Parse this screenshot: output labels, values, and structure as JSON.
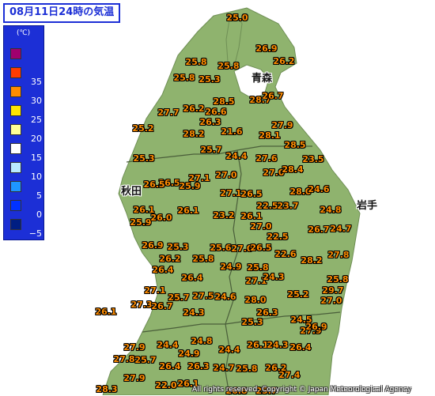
{
  "title": "08月11日24時の気温",
  "legend": {
    "unit": "(℃)",
    "items": [
      {
        "label": "",
        "color": "#a0006e"
      },
      {
        "label": "35",
        "color": "#ff3c00"
      },
      {
        "label": "30",
        "color": "#ff8c00"
      },
      {
        "label": "25",
        "color": "#ffe600"
      },
      {
        "label": "20",
        "color": "#ffff96"
      },
      {
        "label": "15",
        "color": "#ffffff"
      },
      {
        "label": "10",
        "color": "#b9ebff"
      },
      {
        "label": "5",
        "color": "#1e96ff"
      },
      {
        "label": "0",
        "color": "#0032ff"
      },
      {
        "label": "−5",
        "color": "#001e82"
      }
    ]
  },
  "prefectures": [
    "青森",
    "秋田",
    "岩手"
  ],
  "stations": [
    {
      "t": "25.0"
    },
    {
      "t": "26.9"
    },
    {
      "t": "26.2"
    },
    {
      "t": "25.8"
    },
    {
      "t": "25.8"
    },
    {
      "t": "25.8"
    },
    {
      "t": "25.3"
    },
    {
      "t": "28.5"
    },
    {
      "t": "28.7"
    },
    {
      "t": "26.7"
    },
    {
      "t": "27.7"
    },
    {
      "t": "26.2"
    },
    {
      "t": "26.6"
    },
    {
      "t": "26.3"
    },
    {
      "t": "25.2"
    },
    {
      "t": "28.2"
    },
    {
      "t": "21.6"
    },
    {
      "t": "27.9"
    },
    {
      "t": "28.1"
    },
    {
      "t": "25.7"
    },
    {
      "t": "28.5"
    },
    {
      "t": "25.3"
    },
    {
      "t": "24.4"
    },
    {
      "t": "27.6"
    },
    {
      "t": "23.5"
    },
    {
      "t": "27.0"
    },
    {
      "t": "28.4"
    },
    {
      "t": "26.5"
    },
    {
      "t": "27.1"
    },
    {
      "t": "27.0"
    },
    {
      "t": "26.5"
    },
    {
      "t": "25.9"
    },
    {
      "t": "27.1"
    },
    {
      "t": "26.5"
    },
    {
      "t": "28.0"
    },
    {
      "t": "24.6"
    },
    {
      "t": "22.5"
    },
    {
      "t": "23.7"
    },
    {
      "t": "26.1"
    },
    {
      "t": "26.1"
    },
    {
      "t": "23.2"
    },
    {
      "t": "26.1"
    },
    {
      "t": "24.8"
    },
    {
      "t": "25.9"
    },
    {
      "t": "26.0"
    },
    {
      "t": "27.0"
    },
    {
      "t": "26.7"
    },
    {
      "t": "24.7"
    },
    {
      "t": "22.5"
    },
    {
      "t": "26.9"
    },
    {
      "t": "25.3"
    },
    {
      "t": "25.6"
    },
    {
      "t": "27.0"
    },
    {
      "t": "26.5"
    },
    {
      "t": "26.2"
    },
    {
      "t": "25.8"
    },
    {
      "t": "22.6"
    },
    {
      "t": "28.2"
    },
    {
      "t": "27.8"
    },
    {
      "t": "26.4"
    },
    {
      "t": "24.9"
    },
    {
      "t": "25.8"
    },
    {
      "t": "26.4"
    },
    {
      "t": "27.1"
    },
    {
      "t": "24.3"
    },
    {
      "t": "25.8"
    },
    {
      "t": "27.1"
    },
    {
      "t": "25.2"
    },
    {
      "t": "29.7"
    },
    {
      "t": "25.7"
    },
    {
      "t": "27.5"
    },
    {
      "t": "24.6"
    },
    {
      "t": "28.0"
    },
    {
      "t": "27.0"
    },
    {
      "t": "27.3"
    },
    {
      "t": "26.7"
    },
    {
      "t": "26.1"
    },
    {
      "t": "24.3"
    },
    {
      "t": "26.3"
    },
    {
      "t": "25.3"
    },
    {
      "t": "24.5"
    },
    {
      "t": "27.9"
    },
    {
      "t": "26.9"
    },
    {
      "t": "24.8"
    },
    {
      "t": "27.9"
    },
    {
      "t": "24.4"
    },
    {
      "t": "26.1"
    },
    {
      "t": "24.3"
    },
    {
      "t": "26.4"
    },
    {
      "t": "24.4"
    },
    {
      "t": "24.9"
    },
    {
      "t": "27.8"
    },
    {
      "t": "25.7"
    },
    {
      "t": "26.4"
    },
    {
      "t": "26.3"
    },
    {
      "t": "24.7"
    },
    {
      "t": "25.8"
    },
    {
      "t": "26.2"
    },
    {
      "t": "27.9"
    },
    {
      "t": "27.4"
    },
    {
      "t": "22.0"
    },
    {
      "t": "26.1"
    },
    {
      "t": "28.3"
    },
    {
      "t": "26.8"
    },
    {
      "t": "25.7"
    }
  ],
  "copyright": "All rights reserved. Copyright © Japan Meteorological Agency"
}
